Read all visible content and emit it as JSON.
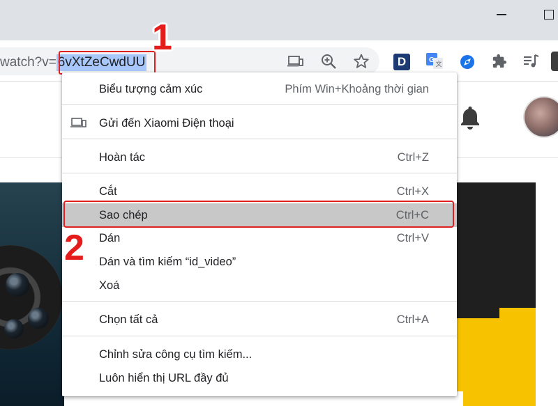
{
  "address_bar": {
    "url_prefix": "watch?v=",
    "url_selected": "6vXtZeCwdUU"
  },
  "toolbar": {
    "icons": [
      "cast-icon",
      "zoom-icon",
      "bookmark-star-icon",
      "extension-d-icon",
      "google-translate-icon",
      "extension-compass-icon",
      "puzzle-extensions-icon",
      "media-control-icon"
    ],
    "extension_d_letter": "D"
  },
  "context_menu": {
    "items": [
      {
        "label": "Biểu tượng cảm xúc",
        "shortcut": "Phím Win+Khoảng thời gian"
      },
      {
        "label": "Gửi đến Xiaomi Điện thoại",
        "shortcut": ""
      },
      {
        "label": "Hoàn tác",
        "shortcut": "Ctrl+Z"
      },
      {
        "label": "Cắt",
        "shortcut": "Ctrl+X"
      },
      {
        "label": "Sao chép",
        "shortcut": "Ctrl+C",
        "highlighted": true
      },
      {
        "label": "Dán",
        "shortcut": "Ctrl+V"
      },
      {
        "label": "Dán và tìm kiếm “id_video”",
        "shortcut": ""
      },
      {
        "label": "Xoá",
        "shortcut": ""
      },
      {
        "label": "Chọn tất cả",
        "shortcut": "Ctrl+A"
      },
      {
        "label": "Chỉnh sửa công cụ tìm kiếm...",
        "shortcut": ""
      },
      {
        "label": "Luôn hiển thị URL đầy đủ",
        "shortcut": ""
      }
    ]
  },
  "annotations": {
    "step1": "1",
    "step2": "2"
  },
  "colors": {
    "selection": "#a8c7fa",
    "annotation_red": "#e51c1c",
    "menu_highlight": "#c8c8c8",
    "accent_yellow": "#f7c300"
  }
}
